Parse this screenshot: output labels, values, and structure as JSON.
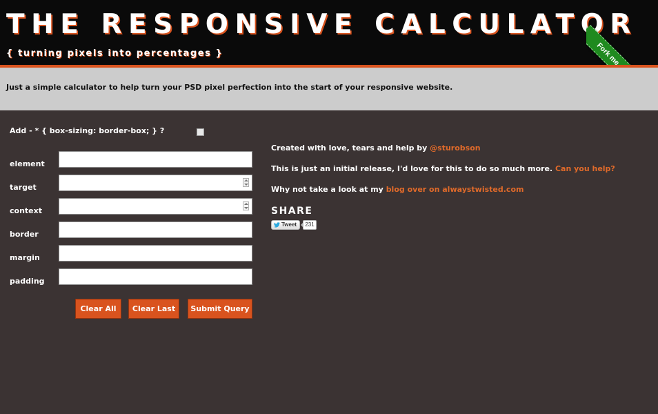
{
  "header": {
    "title": "THE RESPONSIVE CALCULATOR",
    "tagline": "{ turning pixels into percentages }",
    "ribbon_label": "Fork me on GitHub"
  },
  "intro": {
    "text": "Just a simple calculator to help turn your PSD pixel perfection into the start of your responsive website."
  },
  "form": {
    "box_sizing_label": "Add - * { box-sizing: border-box; } ?",
    "box_sizing_checked": false,
    "fields": [
      {
        "label": "element",
        "value": "",
        "type": "text"
      },
      {
        "label": "target",
        "value": "",
        "type": "number"
      },
      {
        "label": "context",
        "value": "",
        "type": "number"
      },
      {
        "label": "border",
        "value": "",
        "type": "text"
      },
      {
        "label": "margin",
        "value": "",
        "type": "text"
      },
      {
        "label": "padding",
        "value": "",
        "type": "text"
      }
    ],
    "buttons": {
      "clear_all": "Clear All",
      "clear_last": "Clear Last",
      "submit": "Submit Query"
    }
  },
  "info": {
    "credit_prefix": "Created with love, tears and help by ",
    "credit_link": "@sturobson",
    "release_prefix": "This is just an initial release, I'd love for this to do so much more. ",
    "release_link": "Can you help?",
    "blog_prefix": "Why not take a look at my ",
    "blog_link": "blog over on alwaystwisted.com"
  },
  "share": {
    "heading": "SHARE",
    "tweet_label": "Tweet",
    "tweet_count": "231"
  },
  "colors": {
    "background": "#3b3333",
    "header_bg": "#0a0a0a",
    "accent": "#d9531e",
    "link": "#e06a2a",
    "intro_bg": "#cccccc",
    "ribbon": "#1f8a1f"
  }
}
